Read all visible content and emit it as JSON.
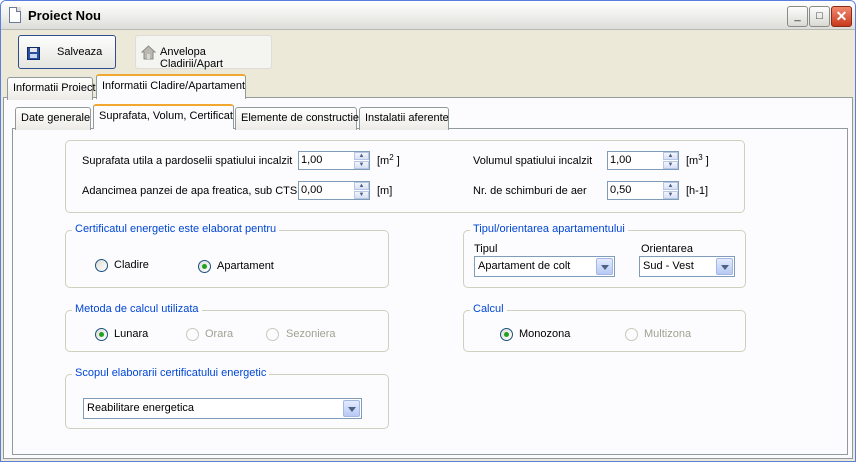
{
  "window": {
    "title": "Proiect Nou",
    "min_glyph": "_",
    "max_glyph": "□",
    "close_glyph": "✕"
  },
  "toolbar": {
    "save_label": "Salveaza",
    "envelope_label": "Anvelopa Cladirii/Apart",
    "save_icon": "floppy-disk-icon",
    "envelope_icon": "house-icon"
  },
  "outer_tabs": [
    {
      "label": "Informatii Proiect",
      "active": false
    },
    {
      "label": "Informatii Cladire/Apartament",
      "active": true
    }
  ],
  "inner_tabs": [
    {
      "label": "Date generale",
      "active": false
    },
    {
      "label": "Suprafata, Volum, Certificat",
      "active": true
    },
    {
      "label": "Elemente de constructie",
      "active": false
    },
    {
      "label": "Instalatii aferente",
      "active": false
    }
  ],
  "dimensions": {
    "area_label": "Suprafata utila a pardoselii spatiului incalzit",
    "area_value": "1,00",
    "area_unit_prefix": "[m",
    "area_unit_exp": "2",
    "area_unit_suffix": " ]",
    "depth_label": "Adancimea panzei de apa freatica, sub CTS",
    "depth_value": "0,00",
    "depth_unit": "[m]",
    "volume_label": "Volumul spatiului incalzit",
    "volume_value": "1,00",
    "volume_unit_prefix": "[m",
    "volume_unit_exp": "3",
    "volume_unit_suffix": " ]",
    "air_label": "Nr. de schimburi de aer",
    "air_value": "0,50",
    "air_unit": "[h-1]"
  },
  "certificate": {
    "legend": "Certificatul energetic este elaborat pentru",
    "options": [
      {
        "label": "Cladire",
        "checked": false
      },
      {
        "label": "Apartament",
        "checked": true
      }
    ]
  },
  "apartment": {
    "legend": "Tipul/orientarea apartamentului",
    "type_label": "Tipul",
    "type_value": "Apartament de colt",
    "orientation_label": "Orientarea",
    "orientation_value": "Sud - Vest"
  },
  "method": {
    "legend": "Metoda de calcul utilizata",
    "options": [
      {
        "label": "Lunara",
        "checked": true,
        "enabled": true
      },
      {
        "label": "Orara",
        "checked": false,
        "enabled": false
      },
      {
        "label": "Sezoniera",
        "checked": false,
        "enabled": false
      }
    ]
  },
  "calc": {
    "legend": "Calcul",
    "options": [
      {
        "label": "Monozona",
        "checked": true,
        "enabled": true
      },
      {
        "label": "Multizona",
        "checked": false,
        "enabled": false
      }
    ]
  },
  "scope": {
    "legend": "Scopul elaborarii certificatului energetic",
    "value": "Reabilitare energetica"
  },
  "colors": {
    "legend": "#0046d5",
    "active_tab_accent": "#f0a830",
    "radio_dot": "#21a121"
  }
}
